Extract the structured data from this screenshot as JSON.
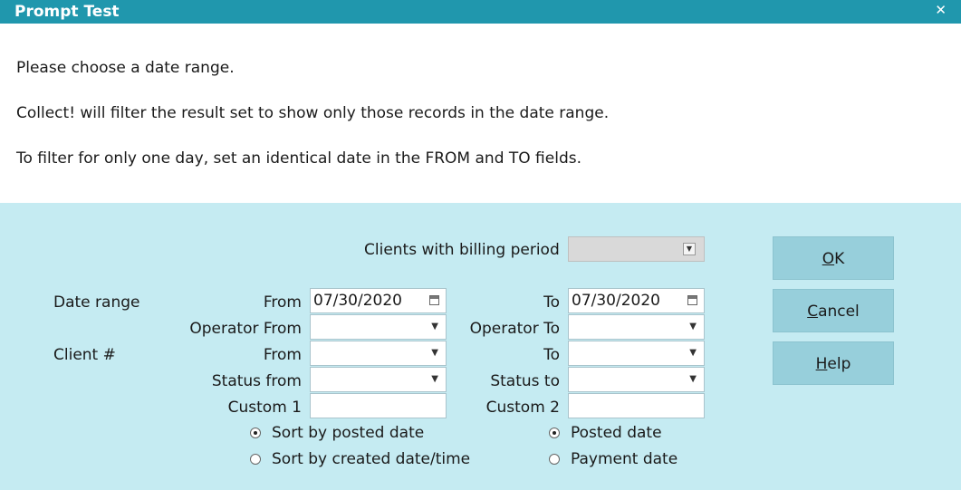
{
  "window": {
    "title": "Prompt Test",
    "close_glyph": "✕"
  },
  "message": {
    "line1": "Please choose a date range.",
    "line2": "Collect! will filter the result set to show only those records in the date range.",
    "line3": "To filter for only one day, set an identical date in the FROM and TO fields."
  },
  "form": {
    "billing_period_label": "Clients with billing period",
    "billing_period_value": "",
    "date_range_label": "Date range",
    "date_from_label": "From",
    "date_from_value": "07/30/2020",
    "date_to_label": "To",
    "date_to_value": "07/30/2020",
    "operator_from_label": "Operator From",
    "operator_from_value": "",
    "operator_to_label": "Operator To",
    "operator_to_value": "",
    "client_label": "Client #",
    "client_from_label": "From",
    "client_from_value": "",
    "client_to_label": "To",
    "client_to_value": "",
    "status_from_label": "Status from",
    "status_from_value": "",
    "status_to_label": "Status to",
    "status_to_value": "",
    "custom1_label": "Custom 1",
    "custom1_value": "",
    "custom2_label": "Custom 2",
    "custom2_value": "",
    "sort_posted_label": "Sort by posted date",
    "sort_created_label": "Sort by created date/time",
    "posted_date_label": "Posted date",
    "payment_date_label": "Payment date",
    "sort_selected": "posted",
    "date_type_selected": "posted"
  },
  "buttons": {
    "ok": {
      "underlined": "O",
      "rest": "K"
    },
    "cancel": {
      "underlined": "C",
      "rest": "ancel"
    },
    "help": {
      "underlined": "H",
      "rest": "elp"
    }
  },
  "icons": {
    "dropdown": "dropdown-arrow-icon",
    "calendar": "calendar-icon",
    "close": "close-icon"
  }
}
